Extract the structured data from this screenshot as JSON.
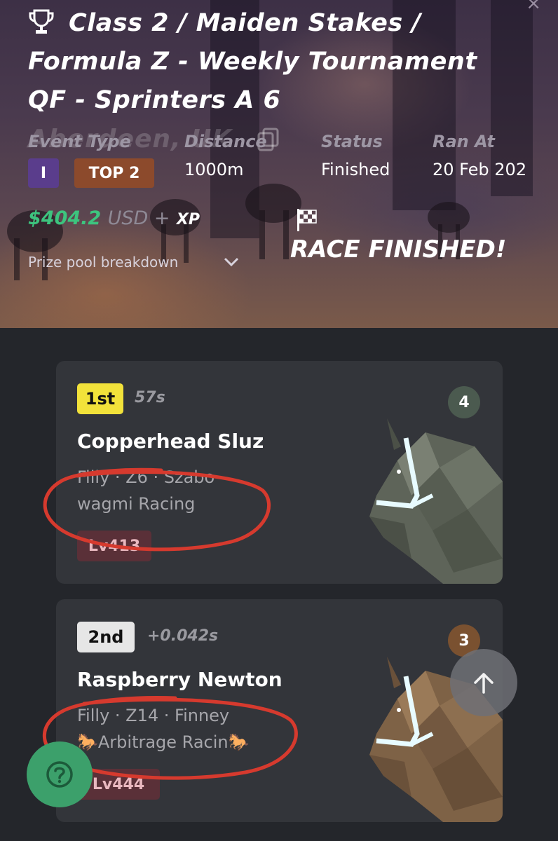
{
  "header": {
    "title": "Class 2 / Maiden Stakes / Formula Z - Weekly Tournament QF - Sprinters A 6",
    "venue": "Aberdeen, UK",
    "close_label": "×"
  },
  "info": {
    "event_type_label": "Event Type",
    "distance_label": "Distance",
    "status_label": "Status",
    "ran_at_label": "Ran At",
    "event_class_badge": "I",
    "event_type_badge": "TOP 2",
    "distance": "1000m",
    "status": "Finished",
    "ran_at": "20 Feb 202"
  },
  "prize": {
    "amount": "$404.2",
    "currency": "USD +",
    "xp": "XP",
    "breakdown_label": "Prize pool breakdown"
  },
  "race_status": "RACE FINISHED!",
  "results": [
    {
      "place": "1st",
      "place_color": "#f2e23a",
      "time": "57s",
      "gate": "4",
      "gate_color": "#4b5a4f",
      "name": "Copperhead Sluz",
      "meta": "Filly · Z6 · Szabo",
      "stable": "wagmi Racing",
      "level": "Lv413",
      "coat_color": "#6b7066"
    },
    {
      "place": "2nd",
      "place_color": "#e6e6e6",
      "time": "+0.042s",
      "gate": "3",
      "gate_color": "#7a5130",
      "name": "Raspberry Newton",
      "meta": "Filly · Z14 · Finney",
      "stable": "🐎Arbitrage Racin🐎",
      "level": "Lv444",
      "coat_color": "#8b6d4e"
    }
  ],
  "annotation_color": "#d63a2e",
  "buttons": {
    "scroll_up_icon": "arrow-up-icon",
    "help_icon": "question-icon"
  }
}
